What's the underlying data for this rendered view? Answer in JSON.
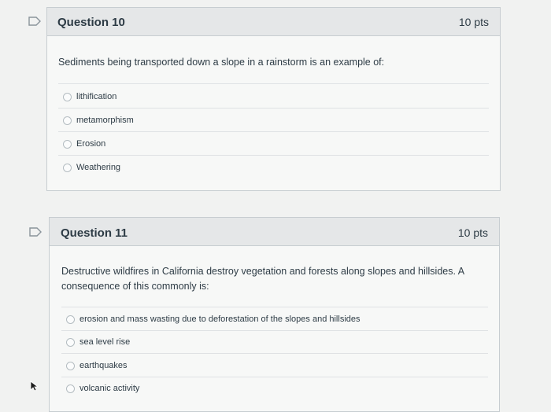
{
  "questions": [
    {
      "title": "Question 10",
      "points": "10 pts",
      "text": "Sediments being transported down a slope in a rainstorm is an example of:",
      "options": [
        "lithification",
        "metamorphism",
        "Erosion",
        "Weathering"
      ]
    },
    {
      "title": "Question 11",
      "points": "10 pts",
      "text": "Destructive wildfires in California destroy vegetation and forests along slopes and hillsides. A consequence of this commonly is:",
      "options": [
        "erosion and mass wasting due to deforestation of the slopes and hillsides",
        "sea level rise",
        "earthquakes",
        "volcanic activity"
      ]
    }
  ],
  "icons": {
    "flag": "flag-question-icon",
    "cursor": "mouse-pointer-icon"
  },
  "colors": {
    "page_bg": "#f1f2f1",
    "header_bg": "#e5e7e8",
    "border": "#c7cdd1",
    "text": "#2d3b45"
  }
}
